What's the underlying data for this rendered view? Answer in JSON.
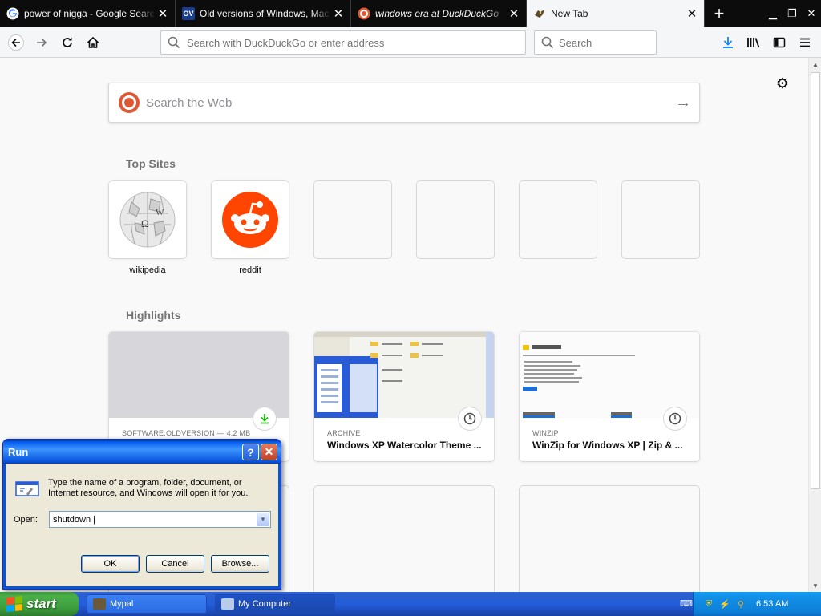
{
  "tabs": [
    {
      "title": "power of nigga - Google Search",
      "favicon": "google-icon",
      "active": false
    },
    {
      "title": "Old versions of Windows, Mac and Linux",
      "favicon": "oldversion-icon",
      "favicon_text": "OV",
      "active": false
    },
    {
      "title": "windows era at DuckDuckGo",
      "favicon": "duckduckgo-icon",
      "active": false
    },
    {
      "title": "New Tab",
      "favicon": "firefox-icon",
      "active": true
    }
  ],
  "navbar": {
    "url_placeholder": "Search with DuckDuckGo or enter address",
    "search_placeholder": "Search"
  },
  "newtab": {
    "websearch_placeholder": "Search the Web",
    "top_sites_title": "Top Sites",
    "top_sites": [
      {
        "label": "wikipedia",
        "icon": "wikipedia-icon"
      },
      {
        "label": "reddit",
        "icon": "reddit-icon"
      },
      {
        "label": ""
      },
      {
        "label": ""
      },
      {
        "label": ""
      },
      {
        "label": ""
      }
    ],
    "highlights_title": "Highlights",
    "highlights": [
      {
        "source": "SOFTWARE.OLDVERSION — 4.2 MB",
        "title": "",
        "badge": "download-icon"
      },
      {
        "source": "ARCHIVE",
        "title": "Windows XP Watercolor Theme ...",
        "badge": "clock-icon"
      },
      {
        "source": "WINZIP",
        "title": "WinZip for Windows XP | Zip & ...",
        "badge": "clock-icon"
      }
    ]
  },
  "run_dialog": {
    "title": "Run",
    "description": "Type the name of a program, folder, document, or Internet resource, and Windows will open it for you.",
    "open_label": "Open:",
    "open_value": "shutdown |",
    "ok_label": "OK",
    "cancel_label": "Cancel",
    "browse_label": "Browse..."
  },
  "taskbar": {
    "start_label": "start",
    "items": [
      {
        "label": "Mypal"
      },
      {
        "label": "My Computer"
      }
    ],
    "clock": "6:53 AM"
  },
  "colors": {
    "firefox_accent": "#0a84ff",
    "reddit": "#ff4500",
    "duckduckgo": "#de5833",
    "xp_taskbar": "#245edb",
    "xp_start": "#3c9a3c"
  }
}
